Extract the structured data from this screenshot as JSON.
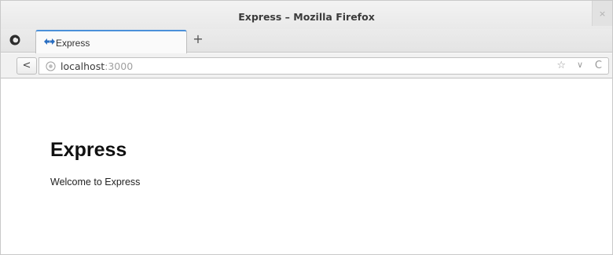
{
  "window": {
    "title": "Express – Mozilla Firefox",
    "close_glyph": "×"
  },
  "tabs": [
    {
      "label": "Express",
      "active": true
    }
  ],
  "new_tab_glyph": "+",
  "navbar": {
    "back_glyph": "<",
    "url_host": "localhost",
    "url_port": ":3000",
    "star_glyph": "☆",
    "dropdown_glyph": "∨",
    "reload_glyph": "C"
  },
  "page": {
    "heading": "Express",
    "text": "Welcome to Express"
  },
  "colors": {
    "tab_accent": "#4a90d9",
    "favicon": "#2b6fc2"
  }
}
